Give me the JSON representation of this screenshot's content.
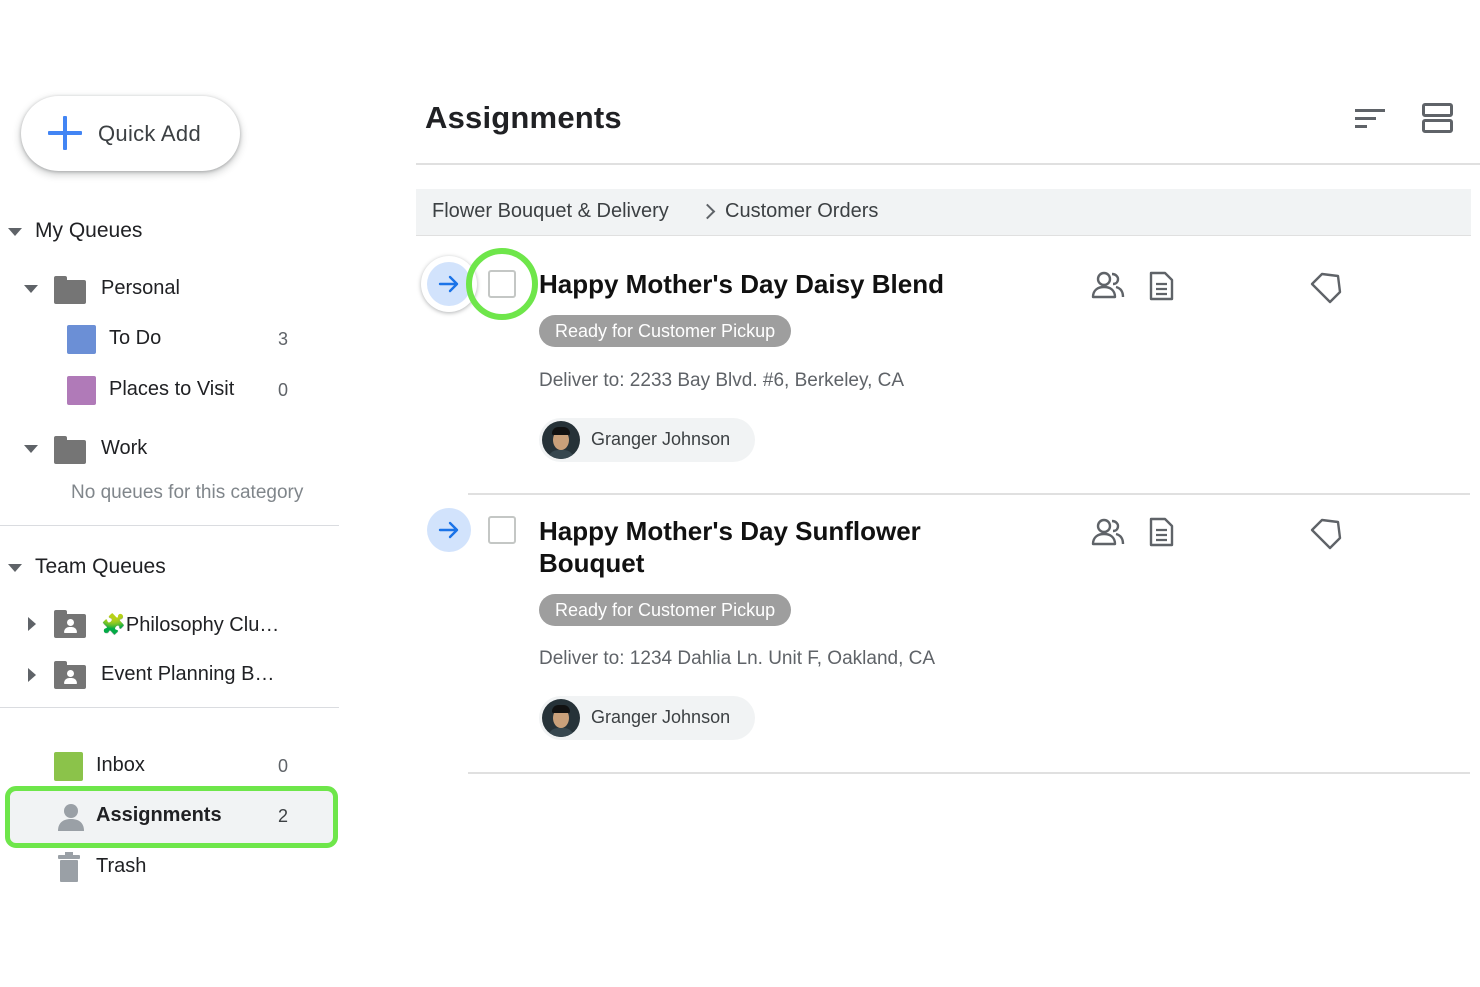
{
  "sidebar": {
    "quick_add_label": "Quick Add",
    "my_queues": {
      "title": "My Queues",
      "personal": {
        "label": "Personal",
        "items": [
          {
            "label": "To Do",
            "count": "3",
            "color": "#6b8fd6"
          },
          {
            "label": "Places to Visit",
            "count": "0",
            "color": "#b07ab8"
          }
        ]
      },
      "work": {
        "label": "Work",
        "empty_text": "No queues for this category"
      }
    },
    "team_queues": {
      "title": "Team Queues",
      "items": [
        {
          "label": "🧩Philosophy Clu…"
        },
        {
          "label": "Event Planning B…"
        }
      ]
    },
    "bottom": {
      "inbox": {
        "label": "Inbox",
        "count": "0",
        "color": "#8bc34a"
      },
      "assignments": {
        "label": "Assignments",
        "count": "2"
      },
      "trash": {
        "label": "Trash"
      }
    }
  },
  "main": {
    "title": "Assignments",
    "breadcrumb": [
      "Flower Bouquet & Delivery",
      "Customer Orders"
    ],
    "items": [
      {
        "title": "Happy Mother's Day Daisy Blend",
        "status": "Ready for Customer Pickup",
        "deliver": "Deliver to: 2233 Bay Blvd. #6, Berkeley, CA",
        "assignee": "Granger Johnson"
      },
      {
        "title": "Happy Mother's Day Sunflower Bouquet",
        "status": "Ready for Customer Pickup",
        "deliver": "Deliver to: 1234 Dahlia Ln. Unit F, Oakland, CA",
        "assignee": "Granger Johnson"
      }
    ]
  },
  "colors": {
    "accent_blue": "#4285f4",
    "highlight_green": "#6ee64a",
    "status_chip": "#9e9e9e",
    "open_button": "#d2e3fc"
  }
}
